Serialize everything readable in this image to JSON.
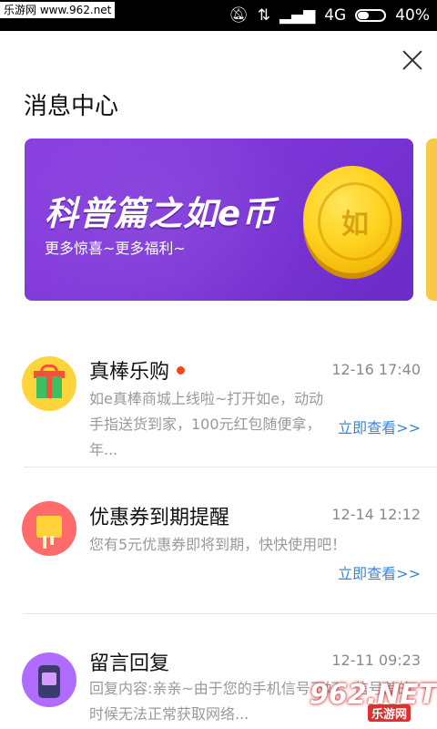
{
  "status_bar": {
    "watermark": "乐游网 www.962.net",
    "network": "4G",
    "battery": "40%",
    "icons": [
      "mute-icon",
      "signal-icon",
      "battery-icon"
    ]
  },
  "header": {
    "title": "消息中心"
  },
  "banner": {
    "title": "科普篇之如e币",
    "subtitle": "更多惊喜~更多福利~",
    "coin_glyph": "如"
  },
  "messages": [
    {
      "title": "真棒乐购",
      "time": "12-16 17:40",
      "body": "如e真棒商城上线啦~打开如e，动动手指送货到家，100元红包随便拿，年...",
      "link": "立即查看>>",
      "unread": true,
      "icon": "gift-icon"
    },
    {
      "title": "优惠券到期提醒",
      "time": "12-14 12:12",
      "body": "您有5元优惠券即将到期，快快使用吧！",
      "link": "立即查看>>",
      "unread": false,
      "icon": "coupon-icon"
    },
    {
      "title": "留言回复",
      "time": "12-11 09:23",
      "body": "回复内容:亲亲~由于您的手机信号不好，信号差的时候无法正常获取网络...",
      "unread": false,
      "icon": "message-phone-icon"
    }
  ],
  "watermark": {
    "logo": "962.NET",
    "sub": "乐游网"
  },
  "colors": {
    "banner": "#7b35d6",
    "link": "#3a86d8",
    "unread_dot": "#f04a1a",
    "next_banner": "#f7c946"
  }
}
